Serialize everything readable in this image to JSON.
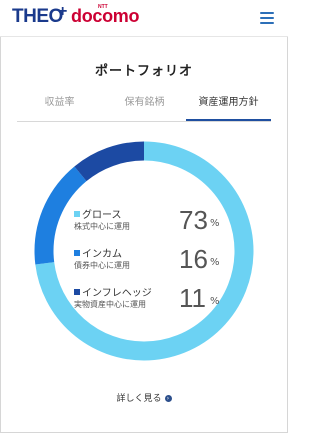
{
  "header": {
    "logo_theo": "THEO",
    "logo_plus": "+",
    "logo_ntt": "NTT",
    "logo_docomo": "docomo",
    "menu_icon": "hamburger-menu-icon"
  },
  "page": {
    "title": "ポートフォリオ"
  },
  "tabs": [
    {
      "label": "収益率",
      "active": false
    },
    {
      "label": "保有銘柄",
      "active": false
    },
    {
      "label": "資産運用方針",
      "active": true
    }
  ],
  "chart_data": {
    "type": "pie",
    "categories": [
      "グロース",
      "インカム",
      "インフレヘッジ"
    ],
    "values": [
      73,
      16,
      11
    ],
    "colors": [
      "#6cd2f3",
      "#1e7fe0",
      "#1c4aa3"
    ],
    "unit": "%"
  },
  "legend": [
    {
      "name": "グロース",
      "sub": "株式中心に運用",
      "value": "73",
      "unit": "%",
      "color": "#6cd2f3"
    },
    {
      "name": "インカム",
      "sub": "債券中心に運用",
      "value": "16",
      "unit": "%",
      "color": "#1e7fe0"
    },
    {
      "name": "インフレヘッジ",
      "sub": "実物資産中心に運用",
      "value": "11",
      "unit": "%",
      "color": "#1c4aa3"
    }
  ],
  "more": {
    "label": "詳しく見る",
    "icon": "chevron-right-circle-icon"
  }
}
